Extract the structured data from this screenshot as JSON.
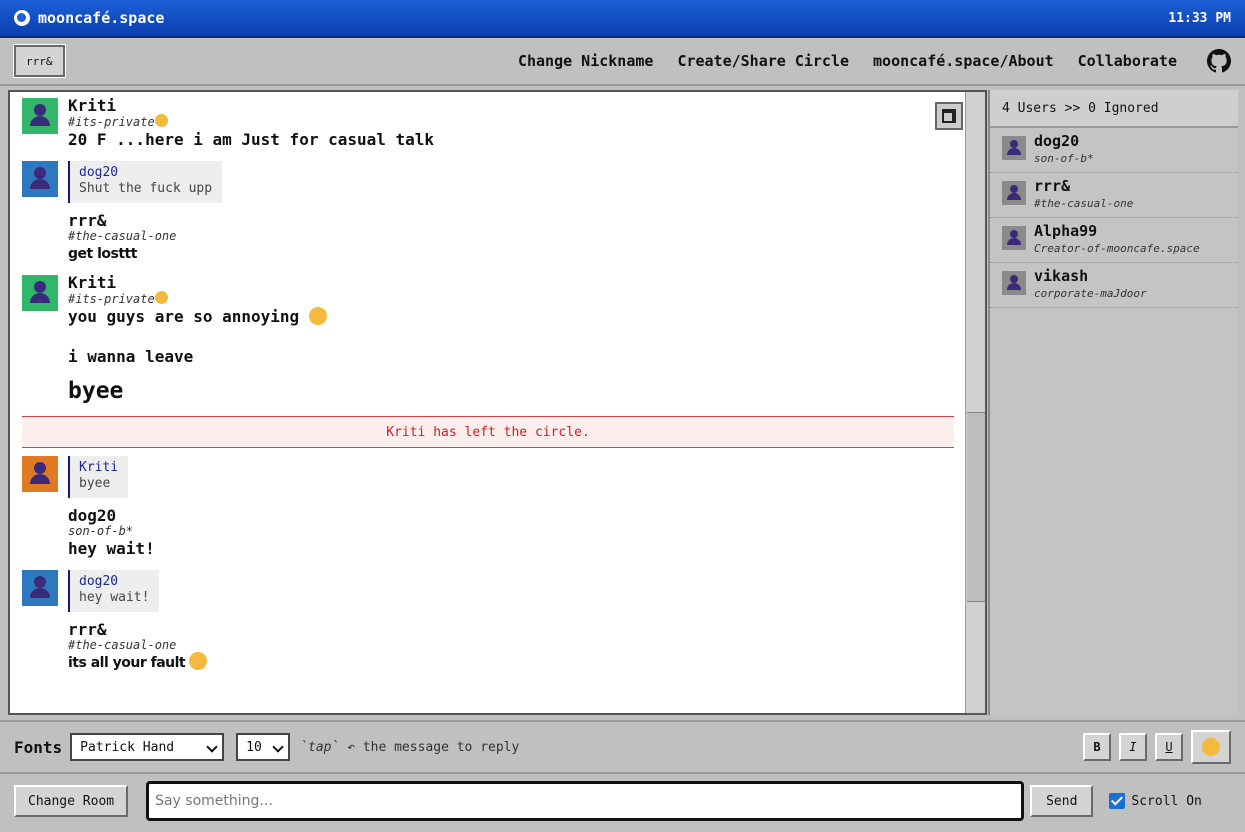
{
  "window": {
    "title": "mooncafé.space",
    "clock": "11:33 PM"
  },
  "nav": {
    "user_label": "rrr&",
    "links": [
      "Change Nickname",
      "Create/Share Circle",
      "mooncafé.space/About",
      "Collaborate"
    ],
    "github_icon": "github-icon"
  },
  "chat": {
    "messages": [
      {
        "user": "Kriti",
        "tag": "#its-private",
        "avatar_color": "#32b66a",
        "lines": [
          "20 F ...here i am Just for casual talk"
        ]
      },
      {
        "quote_user": "dog20",
        "quote_text": "Shut the fuck upp",
        "avatar_color": "#2d78bf"
      },
      {
        "user": "rrr&",
        "tag": "#the-casual-one",
        "lines": [
          "get losttt"
        ]
      },
      {
        "user": "Kriti",
        "tag": "#its-private",
        "avatar_color": "#32b66a",
        "lines": [
          "you guys are so annoying",
          "i wanna leave",
          "byee"
        ]
      },
      {
        "quote_user": "Kriti",
        "quote_text": "byee",
        "avatar_color": "#e07b23"
      },
      {
        "user": "dog20",
        "tag": "son-of-b*",
        "lines": [
          "hey wait!"
        ]
      },
      {
        "quote_user": "dog20",
        "quote_text": "hey wait!",
        "avatar_color": "#2d78bf"
      },
      {
        "user": "rrr&",
        "tag": "#the-casual-one",
        "lines": [
          "its all your fault"
        ]
      }
    ],
    "system_notice": "Kriti has left the circle."
  },
  "users_panel": {
    "header": "4 Users >> 0 Ignored",
    "users": [
      {
        "name": "dog20",
        "tag": "son-of-b*"
      },
      {
        "name": "rrr&",
        "tag": "#the-casual-one"
      },
      {
        "name": "Alpha99",
        "tag": "Creator-of-mooncafe.space"
      },
      {
        "name": "vikash",
        "tag": "corporate-maJdoor"
      }
    ]
  },
  "toolbar": {
    "fonts_label": "Fonts",
    "font_value": "Patrick Hand",
    "size_value": "10",
    "hint_tap": "`tap`",
    "hint_rest": "the message to reply",
    "bold": "B",
    "italic": "I",
    "underline": "U"
  },
  "input": {
    "change_room": "Change Room",
    "placeholder": "Say something...",
    "send": "Send",
    "scroll_label": "Scroll On",
    "scroll_on": true
  }
}
